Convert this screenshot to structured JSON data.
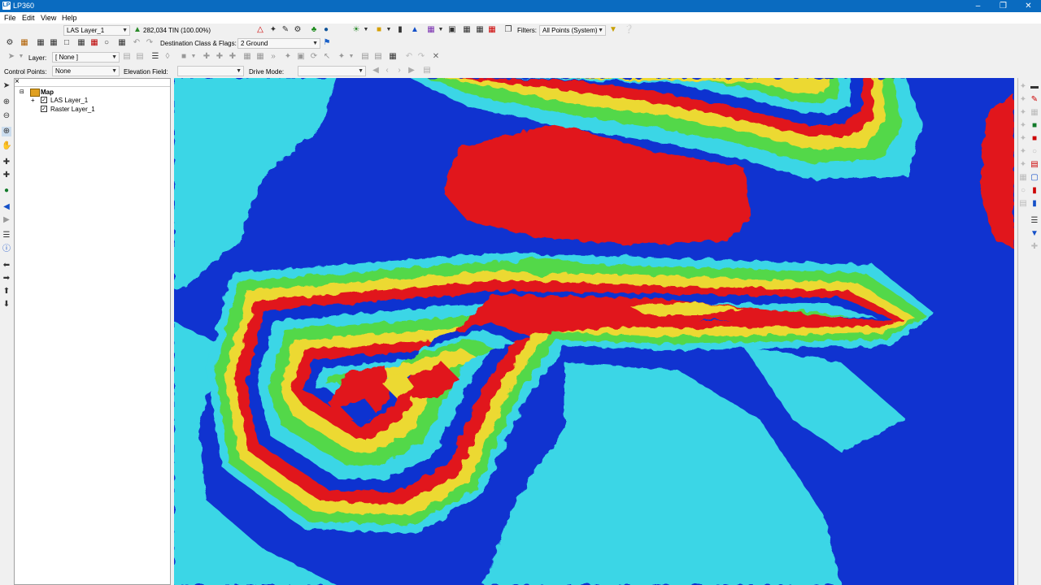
{
  "window": {
    "title": "LP360",
    "app_icon_text": "LP"
  },
  "menu": [
    "File",
    "Edit",
    "View",
    "Help"
  ],
  "toolbar1": {
    "layer_select": "LAS Layer_1",
    "tin_status": "282,034 TIN (100.00%)",
    "filters_label": "Filters:",
    "filters_value": "All Points (System)"
  },
  "toolbar2": {
    "dest_label": "Destination Class & Flags:",
    "dest_value": "2  Ground"
  },
  "toolbar3": {
    "layer_label": "Layer:",
    "layer_value": "[ None ]"
  },
  "toolbar4": {
    "control_label": "Control Points:",
    "control_value": "None",
    "elev_label": "Elevation Field:",
    "elev_value": "",
    "drive_label": "Drive Mode:",
    "drive_value": ""
  },
  "tree": {
    "close": "×",
    "root": "Map",
    "items": [
      {
        "label": "LAS Layer_1",
        "checked": true,
        "expand": "+"
      },
      {
        "label": "Raster Layer_1",
        "checked": true,
        "expand": ""
      }
    ]
  },
  "colors": {
    "titlebar": "#0a6bc0",
    "map_blue": "#1033d0",
    "map_cyan": "#3ad6e6",
    "map_green": "#52d84a",
    "map_yellow": "#ecd930",
    "map_red": "#e1141e"
  }
}
